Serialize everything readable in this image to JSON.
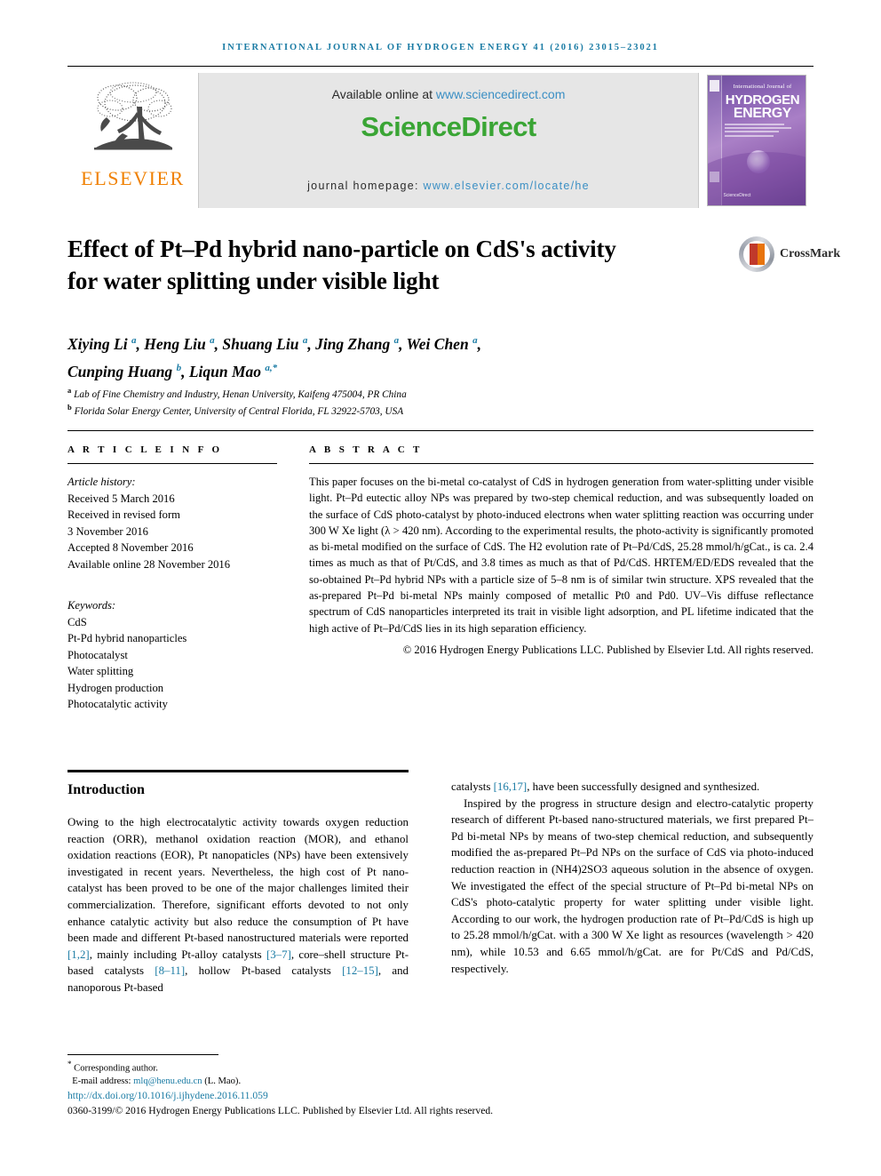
{
  "running_head": "INTERNATIONAL JOURNAL OF HYDROGEN ENERGY 41 (2016) 23015–23021",
  "masthead": {
    "publisher_name": "ELSEVIER",
    "available_prefix": "Available online at ",
    "available_url": "www.sciencedirect.com",
    "sciencedirect_logo": "ScienceDirect",
    "homepage_label": "journal homepage: ",
    "homepage_url": "www.elsevier.com/locate/he",
    "cover": {
      "line1": "International Journal of",
      "line2": "HYDROGEN",
      "line3": "ENERGY",
      "footer": "ScienceDirect"
    }
  },
  "crossmark": {
    "label": "CrossMark"
  },
  "article": {
    "title": "Effect of Pt–Pd hybrid nano-particle on CdS's activity for water splitting under visible light",
    "authors_line1": "Xiying Li a, Heng Liu a, Shuang Liu a, Jing Zhang a, Wei Chen a,",
    "authors_line2": "Cunping Huang b, Liqun Mao a,*",
    "affiliation_a": "Lab of Fine Chemistry and Industry, Henan University, Kaifeng 475004, PR China",
    "affiliation_b": "Florida Solar Energy Center, University of Central Florida, FL 32922-5703, USA"
  },
  "article_info": {
    "heading": "A R T I C L E   I N F O",
    "history_label": "Article history:",
    "history": [
      "Received 5 March 2016",
      "Received in revised form",
      "3 November 2016",
      "Accepted 8 November 2016",
      "Available online 28 November 2016"
    ],
    "keywords_label": "Keywords:",
    "keywords": [
      "CdS",
      "Pt-Pd hybrid nanoparticles",
      "Photocatalyst",
      "Water splitting",
      "Hydrogen production",
      "Photocatalytic activity"
    ]
  },
  "abstract": {
    "heading": "A B S T R A C T",
    "text": "This paper focuses on the bi-metal co-catalyst of CdS in hydrogen generation from water-splitting under visible light. Pt–Pd eutectic alloy NPs was prepared by two-step chemical reduction, and was subsequently loaded on the surface of CdS photo-catalyst by photo-induced electrons when water splitting reaction was occurring under 300 W Xe light (λ > 420 nm). According to the experimental results, the photo-activity is significantly promoted as bi-metal modified on the surface of CdS. The H2 evolution rate of Pt–Pd/CdS, 25.28 mmol/h/gCat., is ca. 2.4 times as much as that of Pt/CdS, and 3.8 times as much as that of Pd/CdS. HRTEM/ED/EDS revealed that the so-obtained Pt–Pd hybrid NPs with a particle size of 5–8 nm is of similar twin structure. XPS revealed that the as-prepared Pt–Pd bi-metal NPs mainly composed of metallic Pt0 and Pd0. UV–Vis diffuse reflectance spectrum of CdS nanoparticles interpreted its trait in visible light adsorption, and PL lifetime indicated that the high active of Pt–Pd/CdS lies in its high separation efficiency.",
    "copyright": "© 2016 Hydrogen Energy Publications LLC. Published by Elsevier Ltd. All rights reserved."
  },
  "introduction": {
    "heading": "Introduction",
    "left_p1_a": "Owing to the high electrocatalytic activity towards oxygen reduction reaction (ORR), methanol oxidation reaction (MOR), and ethanol oxidation reactions (EOR), Pt nanopaticles (NPs) have been extensively investigated in recent years. Nevertheless, the high cost of Pt nano-catalyst has been proved to be one of the major challenges limited their commercialization. Therefore, significant efforts devoted to not only enhance catalytic activity but also reduce the consumption of Pt have been made and different Pt-based nanostructured materials were reported ",
    "cite_1_2": "[1,2]",
    "left_p1_b": ", mainly including Pt-alloy catalysts ",
    "cite_3_7": "[3–7]",
    "left_p1_c": ", core–shell structure Pt-based catalysts ",
    "cite_8_11": "[8–11]",
    "left_p1_d": ", hollow Pt-based catalysts ",
    "cite_12_15": "[12–15]",
    "left_p1_e": ", and nanoporous Pt-based",
    "right_p1_a": "catalysts ",
    "cite_16_17": "[16,17]",
    "right_p1_b": ", have been successfully designed and synthesized.",
    "right_p2": "Inspired by the progress in structure design and electro-catalytic property research of different Pt-based nano-structured materials, we first prepared Pt–Pd bi-metal NPs by means of two-step chemical reduction, and subsequently modified the as-prepared Pt–Pd NPs on the surface of CdS via photo-induced reduction reaction in (NH4)2SO3 aqueous solution in the absence of oxygen. We investigated the effect of the special structure of Pt–Pd bi-metal NPs on CdS's photo-catalytic property for water splitting under visible light. According to our work, the hydrogen production rate of Pt–Pd/CdS is high up to 25.28 mmol/h/gCat. with a 300 W Xe light as resources (wavelength > 420 nm), while 10.53 and 6.65 mmol/h/gCat. are for Pt/CdS and Pd/CdS, respectively."
  },
  "footer": {
    "corresponding": "Corresponding author.",
    "email_label": "E-mail address: ",
    "email": "mlq@henu.edu.cn",
    "email_suffix": " (L. Mao).",
    "doi": "http://dx.doi.org/10.1016/j.ijhydene.2016.11.059",
    "issn_line": "0360-3199/© 2016 Hydrogen Energy Publications LLC. Published by Elsevier Ltd. All rights reserved."
  },
  "colors": {
    "link_blue": "#1a7ba4",
    "elsevier_orange": "#f08000",
    "sciencedirect_green": "#3aa535"
  }
}
